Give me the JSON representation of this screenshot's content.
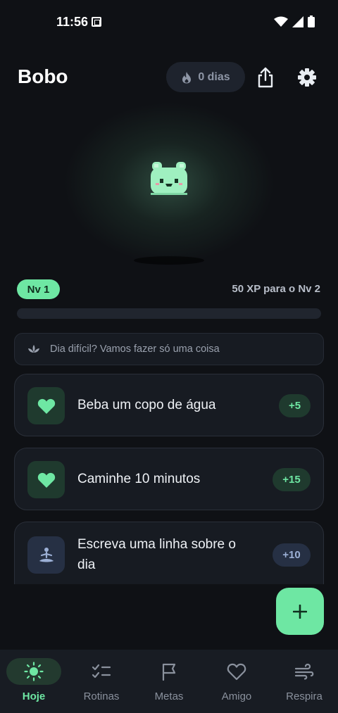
{
  "status_bar": {
    "time": "11:56"
  },
  "header": {
    "title": "Bobo",
    "streak_label": "0 dias"
  },
  "level": {
    "badge": "Nv 1",
    "xp_to_next": "50 XP para o Nv 2",
    "progress_fraction": 0
  },
  "hard_day": {
    "text": "Dia difícil? Vamos fazer só uma coisa"
  },
  "tasks": [
    {
      "label": "Beba um copo de água",
      "xp": "+5",
      "icon": "heart-icon"
    },
    {
      "label": "Caminhe 10 minutos",
      "xp": "+15",
      "icon": "heart-icon"
    },
    {
      "label_line1": "Escreva uma linha sobre o",
      "label_line2": "dia",
      "xp": "+10",
      "icon": "meditation-icon"
    }
  ],
  "fab": {
    "icon": "plus-icon"
  },
  "nav": [
    {
      "label": "Hoje",
      "icon": "sun-icon",
      "active": true
    },
    {
      "label": "Rotinas",
      "icon": "checklist-icon",
      "active": false
    },
    {
      "label": "Metas",
      "icon": "flag-icon",
      "active": false
    },
    {
      "label": "Amigo",
      "icon": "heart-outline-icon",
      "active": false
    },
    {
      "label": "Respira",
      "icon": "wind-icon",
      "active": false
    }
  ],
  "colors": {
    "accent": "#6ee7a3",
    "background": "#0f1115",
    "card": "#171b22",
    "chip_blue": "#263044"
  }
}
